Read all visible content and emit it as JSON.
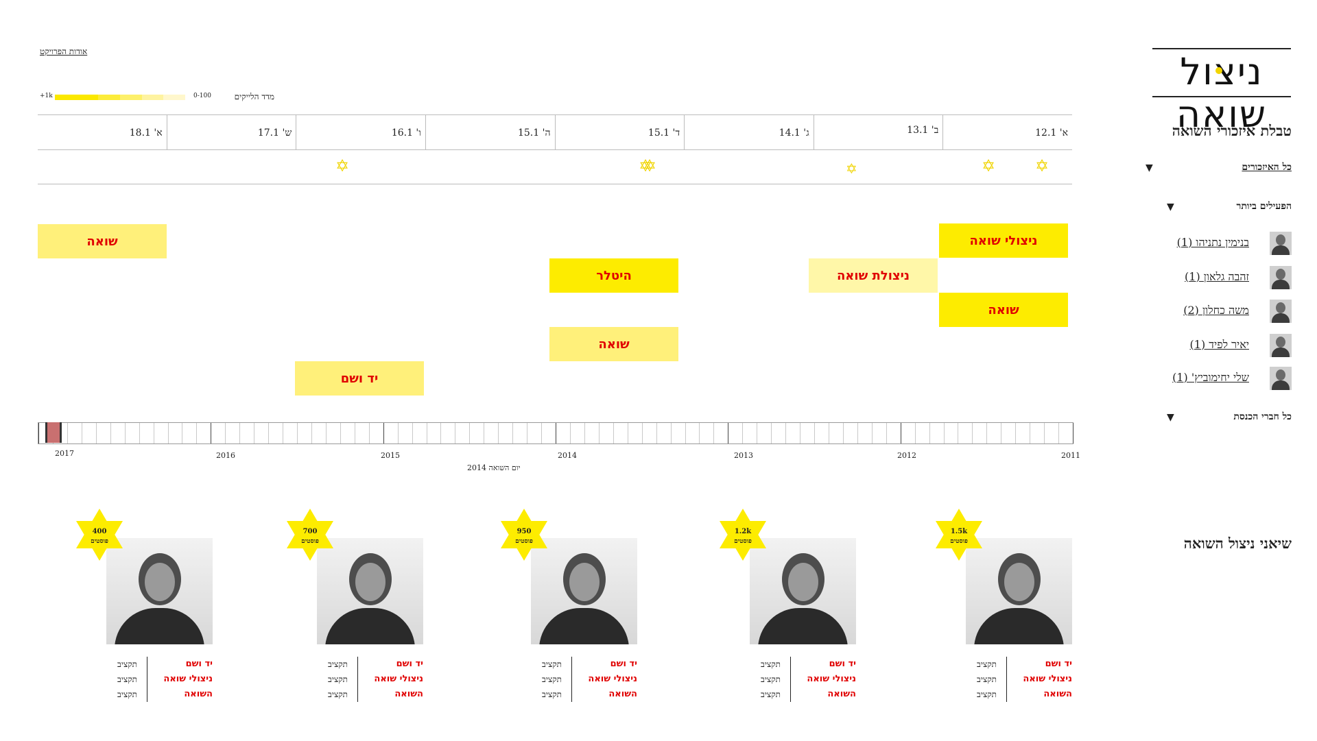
{
  "header": {
    "logo_text": "ניצול שואה",
    "about_link": "אודות הפרויקט",
    "legend": {
      "title": "מדד הלייקים",
      "min_label": "0-100",
      "max_label": "+1k"
    }
  },
  "sidebar": {
    "title": "טבלת איזכורי השואה",
    "all_mentions": "כל האיזכורים",
    "most_active": "הפעילים ביותר",
    "members": [
      {
        "name": "בנימין נתניהו (1)"
      },
      {
        "name": "זהבה גלאון (1)"
      },
      {
        "name": "משה כחלון (2)"
      },
      {
        "name": "יאיר לפיד (1)"
      },
      {
        "name": "שלי יחימוביץ' (1)"
      }
    ],
    "all_members": "כל חברי הכנסת"
  },
  "dates": [
    "א' 12.1",
    "ב' 13.1",
    "ג' 14.1",
    "ד' 15.1",
    "ה' 15.1",
    "ו' 16.1",
    "ש' 17.1",
    "א' 18.1"
  ],
  "tags": {
    "t1": "ניצולי שואה",
    "t2": "ניצולת שואה",
    "t3": "שואה",
    "t4": "היטלר",
    "t5": "שואה",
    "t6": "יד ושם",
    "t7": "שואה"
  },
  "timeline": {
    "years": [
      "2017",
      "2016",
      "2015",
      "2014",
      "2013",
      "2012",
      "2011"
    ],
    "event_label": "יום השואה 2014"
  },
  "people_section": {
    "title": "שיאני ניצול השואה",
    "posts_label": "פוסטים",
    "tag_list": [
      "יד ושם",
      "ניצולי שואה",
      "השואה"
    ],
    "excerpt_label": "תקציב",
    "persons": [
      {
        "posts": "1.5k"
      },
      {
        "posts": "1.2k"
      },
      {
        "posts": "950"
      },
      {
        "posts": "700"
      },
      {
        "posts": "400"
      }
    ]
  },
  "colors": {
    "accent": "#fdec00",
    "light": "#fff07a",
    "pale": "#fff7a8",
    "text_red": "#e00000"
  }
}
